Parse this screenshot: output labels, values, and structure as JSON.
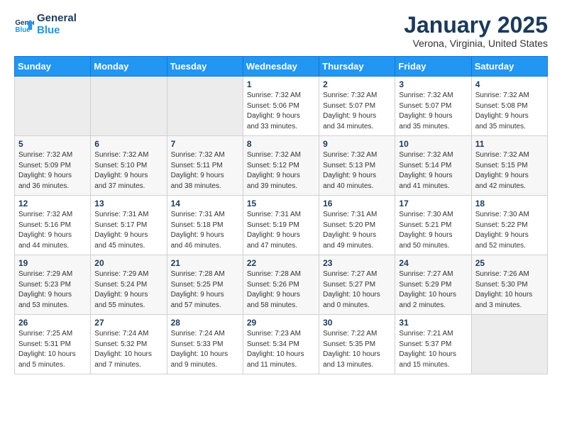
{
  "logo": {
    "line1": "General",
    "line2": "Blue"
  },
  "title": "January 2025",
  "subtitle": "Verona, Virginia, United States",
  "headers": [
    "Sunday",
    "Monday",
    "Tuesday",
    "Wednesday",
    "Thursday",
    "Friday",
    "Saturday"
  ],
  "weeks": [
    [
      {
        "day": "",
        "empty": true
      },
      {
        "day": "",
        "empty": true
      },
      {
        "day": "",
        "empty": true
      },
      {
        "day": "1",
        "lines": [
          "Sunrise: 7:32 AM",
          "Sunset: 5:06 PM",
          "Daylight: 9 hours",
          "and 33 minutes."
        ]
      },
      {
        "day": "2",
        "lines": [
          "Sunrise: 7:32 AM",
          "Sunset: 5:07 PM",
          "Daylight: 9 hours",
          "and 34 minutes."
        ]
      },
      {
        "day": "3",
        "lines": [
          "Sunrise: 7:32 AM",
          "Sunset: 5:07 PM",
          "Daylight: 9 hours",
          "and 35 minutes."
        ]
      },
      {
        "day": "4",
        "lines": [
          "Sunrise: 7:32 AM",
          "Sunset: 5:08 PM",
          "Daylight: 9 hours",
          "and 35 minutes."
        ]
      }
    ],
    [
      {
        "day": "5",
        "lines": [
          "Sunrise: 7:32 AM",
          "Sunset: 5:09 PM",
          "Daylight: 9 hours",
          "and 36 minutes."
        ]
      },
      {
        "day": "6",
        "lines": [
          "Sunrise: 7:32 AM",
          "Sunset: 5:10 PM",
          "Daylight: 9 hours",
          "and 37 minutes."
        ]
      },
      {
        "day": "7",
        "lines": [
          "Sunrise: 7:32 AM",
          "Sunset: 5:11 PM",
          "Daylight: 9 hours",
          "and 38 minutes."
        ]
      },
      {
        "day": "8",
        "lines": [
          "Sunrise: 7:32 AM",
          "Sunset: 5:12 PM",
          "Daylight: 9 hours",
          "and 39 minutes."
        ]
      },
      {
        "day": "9",
        "lines": [
          "Sunrise: 7:32 AM",
          "Sunset: 5:13 PM",
          "Daylight: 9 hours",
          "and 40 minutes."
        ]
      },
      {
        "day": "10",
        "lines": [
          "Sunrise: 7:32 AM",
          "Sunset: 5:14 PM",
          "Daylight: 9 hours",
          "and 41 minutes."
        ]
      },
      {
        "day": "11",
        "lines": [
          "Sunrise: 7:32 AM",
          "Sunset: 5:15 PM",
          "Daylight: 9 hours",
          "and 42 minutes."
        ]
      }
    ],
    [
      {
        "day": "12",
        "lines": [
          "Sunrise: 7:32 AM",
          "Sunset: 5:16 PM",
          "Daylight: 9 hours",
          "and 44 minutes."
        ]
      },
      {
        "day": "13",
        "lines": [
          "Sunrise: 7:31 AM",
          "Sunset: 5:17 PM",
          "Daylight: 9 hours",
          "and 45 minutes."
        ]
      },
      {
        "day": "14",
        "lines": [
          "Sunrise: 7:31 AM",
          "Sunset: 5:18 PM",
          "Daylight: 9 hours",
          "and 46 minutes."
        ]
      },
      {
        "day": "15",
        "lines": [
          "Sunrise: 7:31 AM",
          "Sunset: 5:19 PM",
          "Daylight: 9 hours",
          "and 47 minutes."
        ]
      },
      {
        "day": "16",
        "lines": [
          "Sunrise: 7:31 AM",
          "Sunset: 5:20 PM",
          "Daylight: 9 hours",
          "and 49 minutes."
        ]
      },
      {
        "day": "17",
        "lines": [
          "Sunrise: 7:30 AM",
          "Sunset: 5:21 PM",
          "Daylight: 9 hours",
          "and 50 minutes."
        ]
      },
      {
        "day": "18",
        "lines": [
          "Sunrise: 7:30 AM",
          "Sunset: 5:22 PM",
          "Daylight: 9 hours",
          "and 52 minutes."
        ]
      }
    ],
    [
      {
        "day": "19",
        "lines": [
          "Sunrise: 7:29 AM",
          "Sunset: 5:23 PM",
          "Daylight: 9 hours",
          "and 53 minutes."
        ]
      },
      {
        "day": "20",
        "lines": [
          "Sunrise: 7:29 AM",
          "Sunset: 5:24 PM",
          "Daylight: 9 hours",
          "and 55 minutes."
        ]
      },
      {
        "day": "21",
        "lines": [
          "Sunrise: 7:28 AM",
          "Sunset: 5:25 PM",
          "Daylight: 9 hours",
          "and 57 minutes."
        ]
      },
      {
        "day": "22",
        "lines": [
          "Sunrise: 7:28 AM",
          "Sunset: 5:26 PM",
          "Daylight: 9 hours",
          "and 58 minutes."
        ]
      },
      {
        "day": "23",
        "lines": [
          "Sunrise: 7:27 AM",
          "Sunset: 5:27 PM",
          "Daylight: 10 hours",
          "and 0 minutes."
        ]
      },
      {
        "day": "24",
        "lines": [
          "Sunrise: 7:27 AM",
          "Sunset: 5:29 PM",
          "Daylight: 10 hours",
          "and 2 minutes."
        ]
      },
      {
        "day": "25",
        "lines": [
          "Sunrise: 7:26 AM",
          "Sunset: 5:30 PM",
          "Daylight: 10 hours",
          "and 3 minutes."
        ]
      }
    ],
    [
      {
        "day": "26",
        "lines": [
          "Sunrise: 7:25 AM",
          "Sunset: 5:31 PM",
          "Daylight: 10 hours",
          "and 5 minutes."
        ]
      },
      {
        "day": "27",
        "lines": [
          "Sunrise: 7:24 AM",
          "Sunset: 5:32 PM",
          "Daylight: 10 hours",
          "and 7 minutes."
        ]
      },
      {
        "day": "28",
        "lines": [
          "Sunrise: 7:24 AM",
          "Sunset: 5:33 PM",
          "Daylight: 10 hours",
          "and 9 minutes."
        ]
      },
      {
        "day": "29",
        "lines": [
          "Sunrise: 7:23 AM",
          "Sunset: 5:34 PM",
          "Daylight: 10 hours",
          "and 11 minutes."
        ]
      },
      {
        "day": "30",
        "lines": [
          "Sunrise: 7:22 AM",
          "Sunset: 5:35 PM",
          "Daylight: 10 hours",
          "and 13 minutes."
        ]
      },
      {
        "day": "31",
        "lines": [
          "Sunrise: 7:21 AM",
          "Sunset: 5:37 PM",
          "Daylight: 10 hours",
          "and 15 minutes."
        ]
      },
      {
        "day": "",
        "empty": true
      }
    ]
  ]
}
